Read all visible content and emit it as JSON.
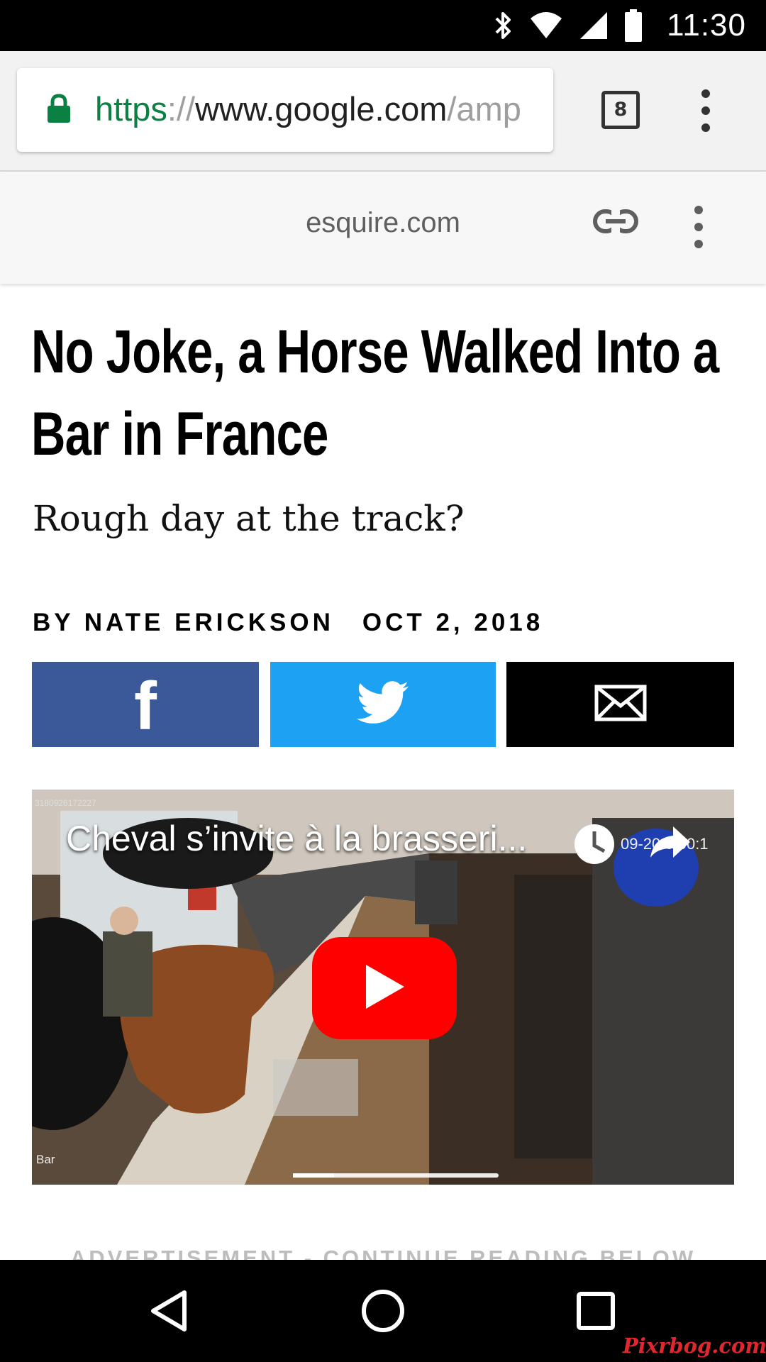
{
  "status_bar": {
    "time": "11:30",
    "icons": [
      "bluetooth-icon",
      "wifi-icon",
      "cell-signal-icon",
      "battery-icon"
    ]
  },
  "browser": {
    "url": {
      "scheme": "https",
      "separator": "://",
      "host": "www.google.com",
      "path": "/amp"
    },
    "tab_count": "8"
  },
  "amp_header": {
    "domain": "esquire.com"
  },
  "article": {
    "headline": "No Joke, a Horse Walked Into a Bar in France",
    "dek": "Rough day at the track?",
    "byline": "BY NATE ERICKSON",
    "date": "OCT 2, 2018"
  },
  "share": {
    "colors": {
      "facebook": "#3b5998",
      "twitter": "#1da1f2",
      "email": "#000000"
    },
    "facebook_glyph": "f"
  },
  "video": {
    "title": "Cheval s’invite à la brasseri...",
    "camera_stamp": "3180926172227",
    "camera_time": "09-20   0:00:1",
    "corner_label": "Bar",
    "progress_fraction": 0.2
  },
  "ad_label": "ADVERTISEMENT - CONTINUE READING BELOW",
  "watermark": "Pixrbog.com"
}
